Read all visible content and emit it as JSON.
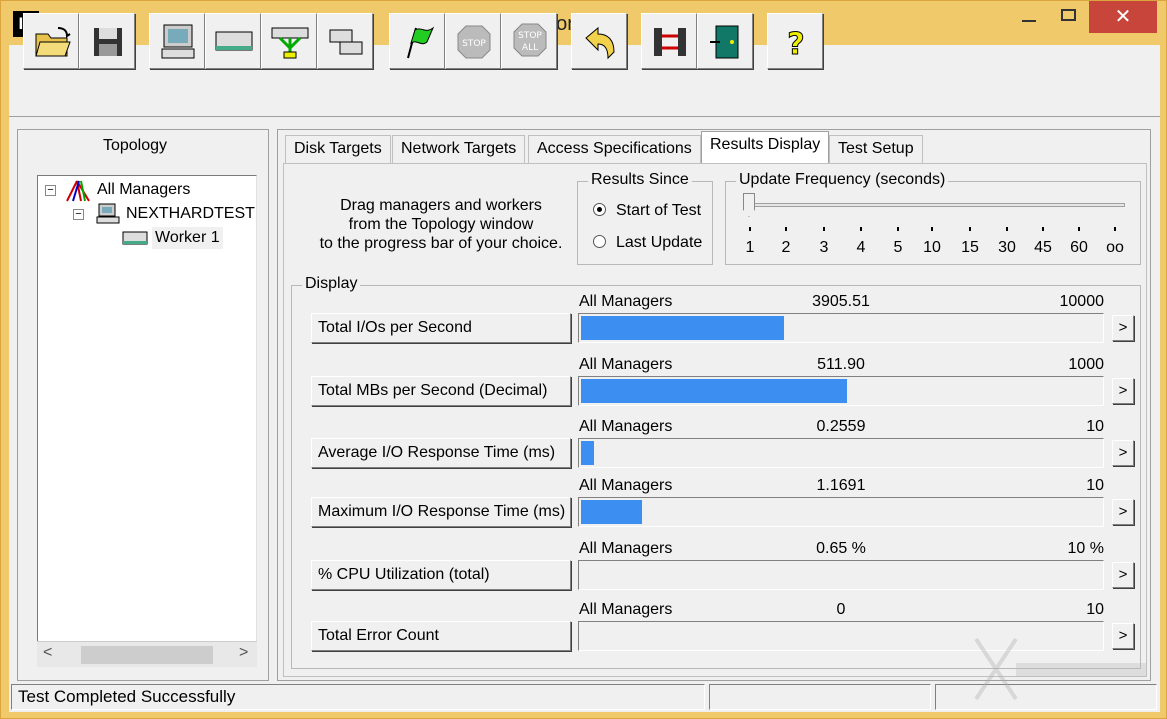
{
  "window": {
    "app_icon": "Io",
    "title": "Iometer",
    "minimize_icon": "minimize-icon",
    "maximize_icon": "maximize-icon",
    "close_icon": "close-icon",
    "close_glyph": "✕"
  },
  "toolbar": {
    "buttons": [
      {
        "name": "open-config-button",
        "icon": "open-folder-icon"
      },
      {
        "name": "save-config-button",
        "icon": "floppy-disk-icon"
      },
      {
        "name": "start-manager-button",
        "icon": "computer-icon"
      },
      {
        "name": "start-disk-worker-button",
        "icon": "disk-worker-icon"
      },
      {
        "name": "start-network-worker-button",
        "icon": "network-worker-icon"
      },
      {
        "name": "duplicate-worker-button",
        "icon": "duplicate-icon"
      },
      {
        "name": "start-tests-button",
        "icon": "green-flag-icon"
      },
      {
        "name": "stop-button",
        "icon": "stop-icon",
        "label": "STOP"
      },
      {
        "name": "stop-all-button",
        "icon": "stop-all-icon",
        "label": "STOP",
        "label2": "ALL"
      },
      {
        "name": "reset-workers-button",
        "icon": "undo-arrow-icon"
      },
      {
        "name": "disconnect-button",
        "icon": "disconnect-icon"
      },
      {
        "name": "exit-button",
        "icon": "exit-door-icon"
      },
      {
        "name": "about-button",
        "icon": "question-icon",
        "label": "?"
      }
    ]
  },
  "topology": {
    "title": "Topology",
    "nodes": [
      {
        "label": "All Managers",
        "icon": "all-managers-icon",
        "expander": "−"
      },
      {
        "label": "NEXTHARDTEST",
        "icon": "computer-icon",
        "expander": "−"
      },
      {
        "label": "Worker 1",
        "icon": "disk-worker-icon"
      }
    ],
    "scroll_left": "<",
    "scroll_right": ">"
  },
  "tabs": [
    {
      "label": "Disk Targets"
    },
    {
      "label": "Network Targets"
    },
    {
      "label": "Access Specifications"
    },
    {
      "label": "Results Display",
      "active": true
    },
    {
      "label": "Test Setup"
    }
  ],
  "results": {
    "hint_lines": [
      "Drag managers and workers",
      "from the Topology window",
      "to the progress bar of your choice."
    ],
    "results_since": {
      "title": "Results Since",
      "options": [
        {
          "label": "Start of Test",
          "selected": true
        },
        {
          "label": "Last Update",
          "selected": false
        }
      ]
    },
    "update_frequency": {
      "title": "Update Frequency (seconds)",
      "ticks": [
        "1",
        "2",
        "3",
        "4",
        "5",
        "10",
        "15",
        "30",
        "45",
        "60",
        "oo"
      ],
      "selected": "1"
    },
    "display_title": "Display",
    "metrics": [
      {
        "label": "Total I/Os per Second",
        "source": "All Managers",
        "value": "3905.51",
        "max": "10000",
        "fraction": 0.3906
      },
      {
        "label": "Total MBs per Second (Decimal)",
        "source": "All Managers",
        "value": "511.90",
        "max": "1000",
        "fraction": 0.5119
      },
      {
        "label": "Average I/O Response Time (ms)",
        "source": "All Managers",
        "value": "0.2559",
        "max": "10",
        "fraction": 0.0256
      },
      {
        "label": "Maximum I/O Response Time (ms)",
        "source": "All Managers",
        "value": "1.1691",
        "max": "10",
        "fraction": 0.1169
      },
      {
        "label": "% CPU Utilization (total)",
        "source": "All Managers",
        "value": "0.65 %",
        "max": "10 %",
        "fraction": 0.0
      },
      {
        "label": "Total Error Count",
        "source": "All Managers",
        "value": "0",
        "max": "10",
        "fraction": 0.0
      }
    ],
    "more_glyph": ">"
  },
  "status": {
    "message": "Test Completed Successfully"
  },
  "colors": {
    "bar": "#3c8ff0",
    "title_bar": "#f0ca6a",
    "close": "#c7453a"
  }
}
